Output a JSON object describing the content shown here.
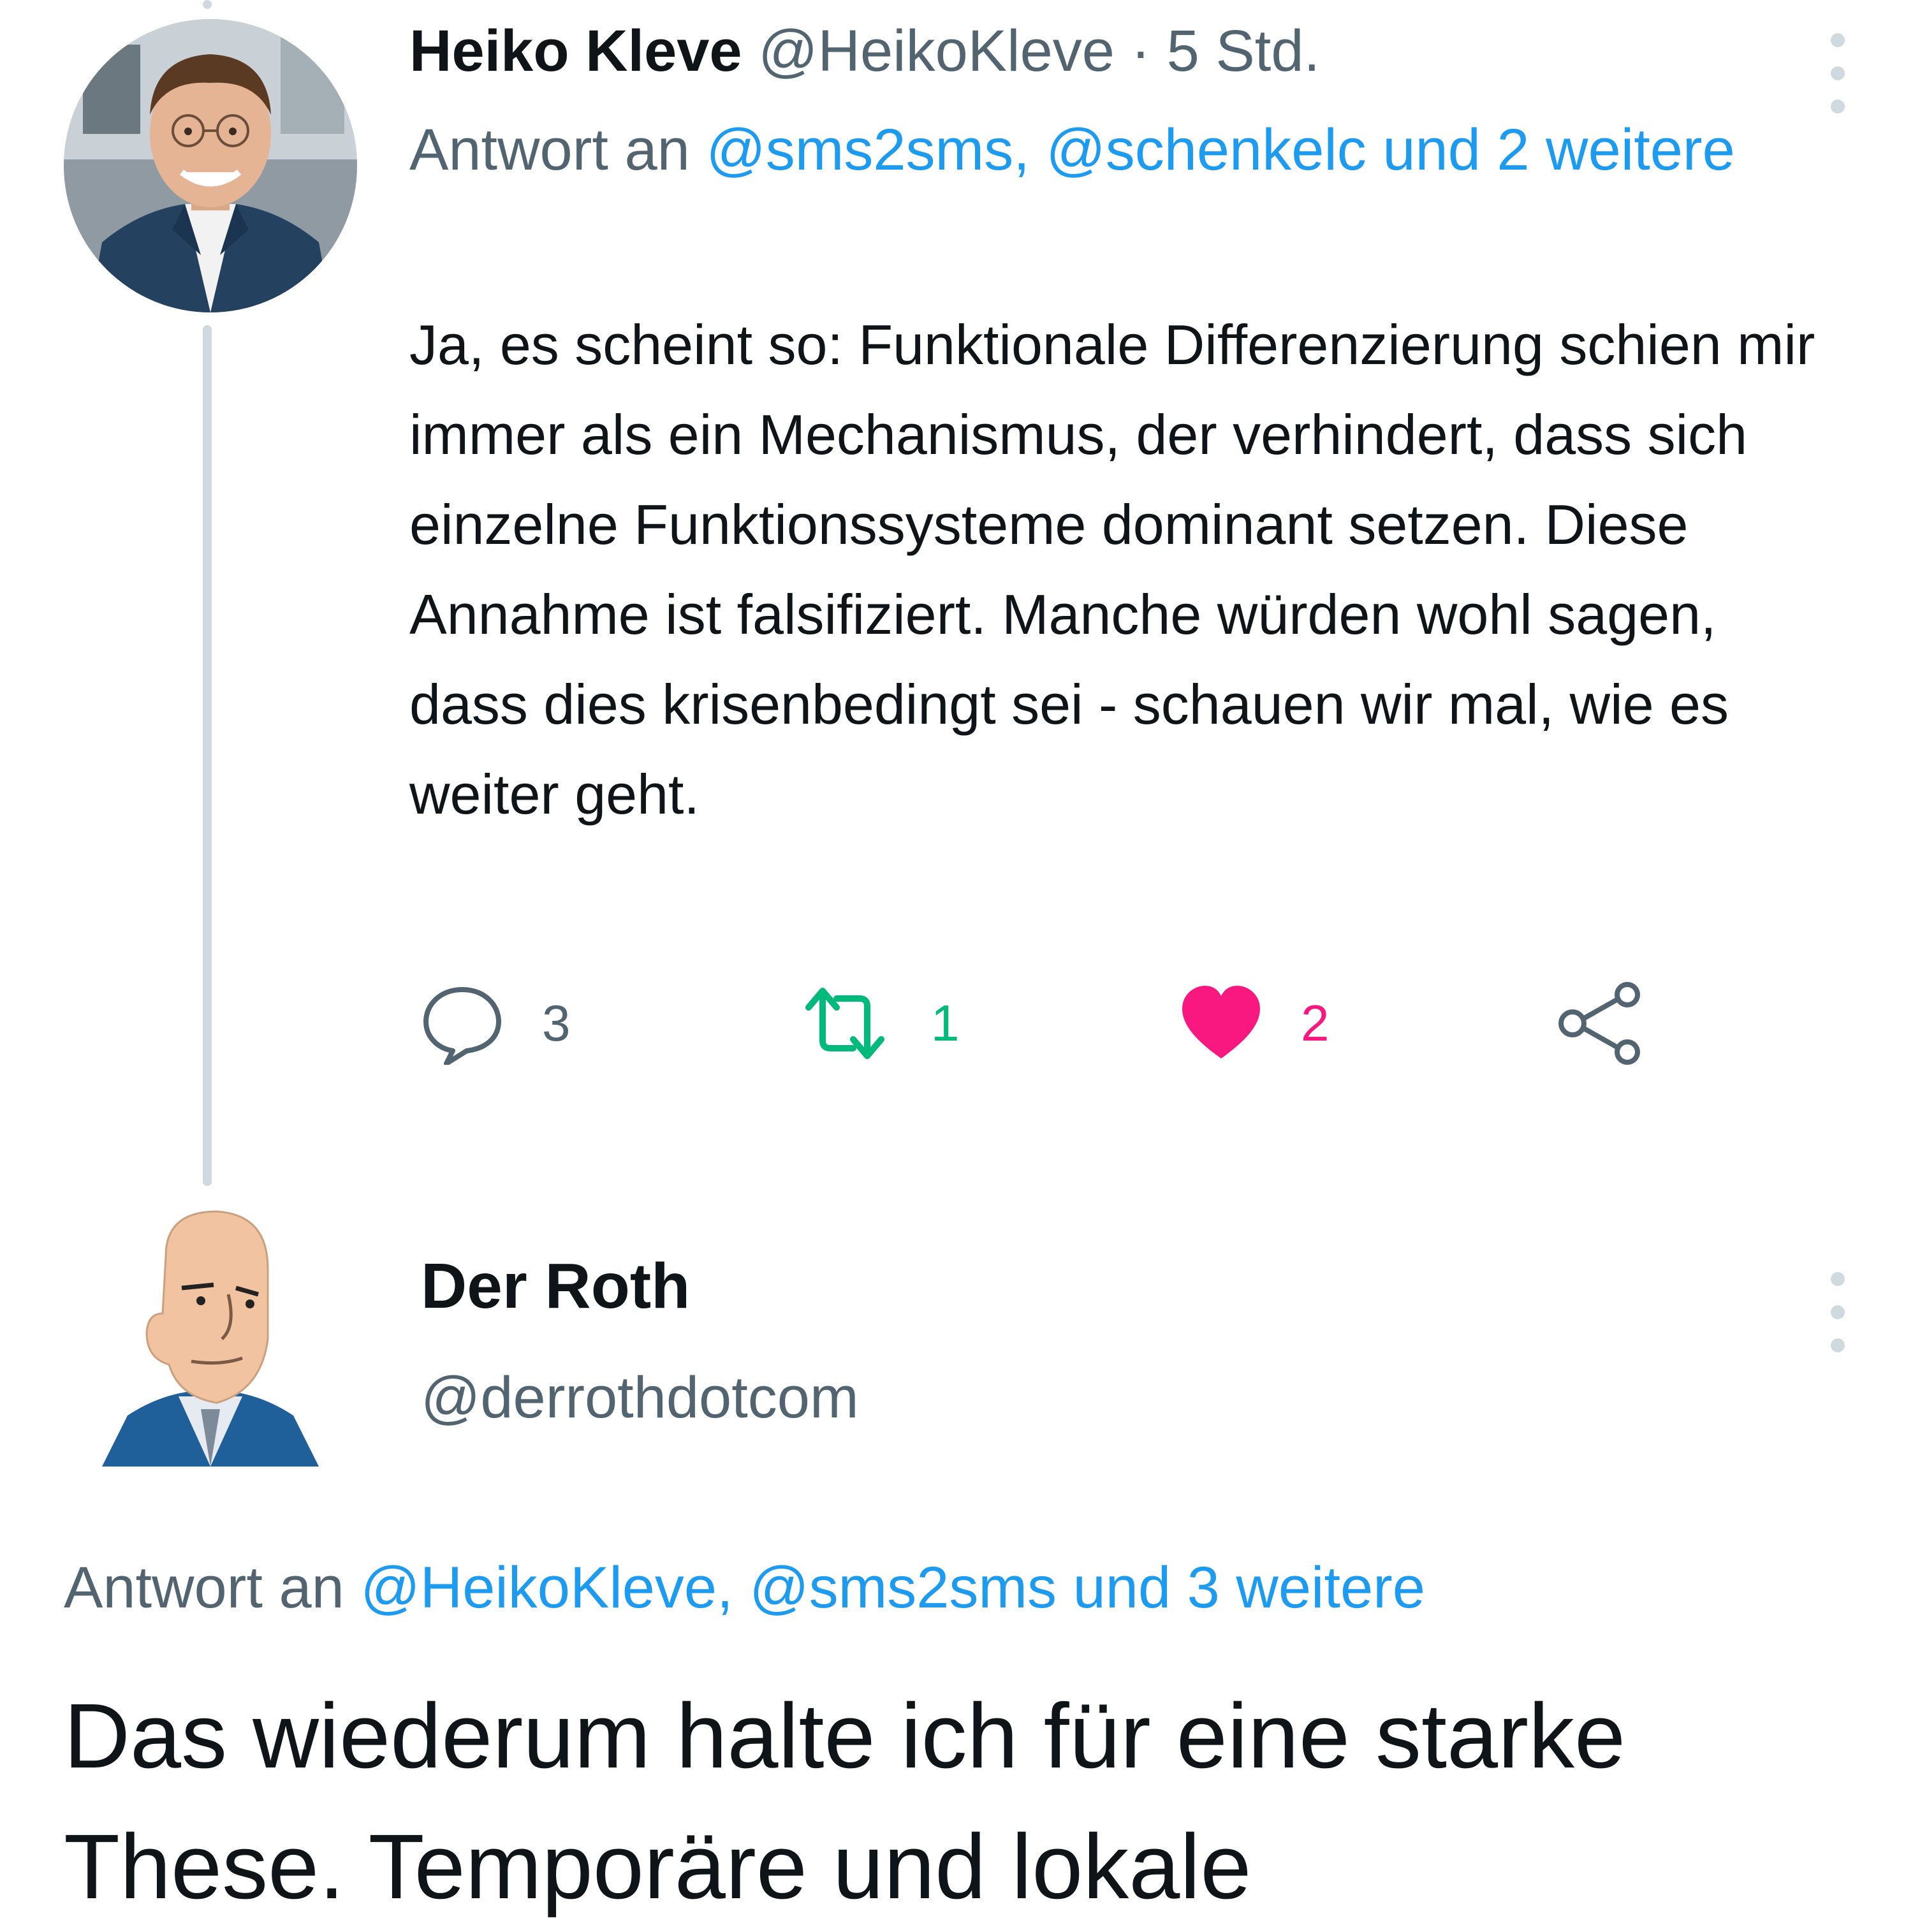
{
  "tweet1": {
    "author_name": "Heiko Kleve",
    "author_handle": "@HeikoKleve",
    "separator": "·",
    "time": "5 Std.",
    "reply_prefix": "Antwort an",
    "reply_targets": "@sms2sms, @schenkelc und 2 weitere",
    "body": "Ja, es scheint so: Funktionale Differenzierung schien mir immer als ein Mechanismus, der verhindert, dass sich einzelne Funktionssysteme dominant setzen. Diese Annahme ist falsifiziert. Manche würden wohl sagen, dass dies krisenbedingt sei - schauen wir mal, wie es weiter geht.",
    "actions": {
      "reply_count": "3",
      "retweet_count": "1",
      "like_count": "2"
    }
  },
  "tweet2": {
    "author_name": "Der Roth",
    "author_handle": "@derrothdotcom",
    "reply_prefix": "Antwort an",
    "reply_targets": "@HeikoKleve, @sms2sms und 3 weitere",
    "body": "Das wiederum halte ich für eine starke These. Temporäre und lokale"
  },
  "colors": {
    "link": "#1d9bf0",
    "muted": "#536471",
    "retweet_active": "#00ba7c",
    "like_active": "#f91880",
    "thread_line": "#cfd9de"
  },
  "icons": {
    "reply": "speech-bubble-icon",
    "retweet": "retweet-icon",
    "like": "heart-icon",
    "share": "share-icon",
    "more": "more-vertical-icon"
  }
}
